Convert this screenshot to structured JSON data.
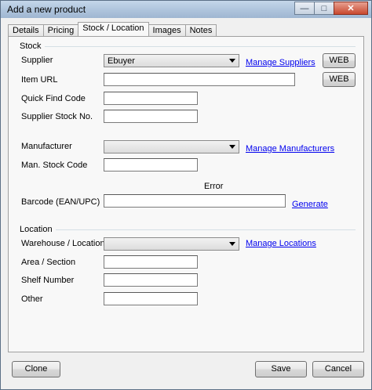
{
  "window": {
    "title": "Add a new product",
    "minimize_glyph": "—",
    "maximize_glyph": "□",
    "close_glyph": "✕"
  },
  "tabs": [
    {
      "label": "Details"
    },
    {
      "label": "Pricing"
    },
    {
      "label": "Stock / Location"
    },
    {
      "label": "Images"
    },
    {
      "label": "Notes"
    }
  ],
  "stock": {
    "group_label": "Stock",
    "supplier_label": "Supplier",
    "supplier_value": "Ebuyer",
    "manage_suppliers": "Manage Suppliers",
    "web_label": "WEB",
    "item_url_label": "Item URL",
    "item_url_value": "",
    "quick_find_label": "Quick Find Code",
    "quick_find_value": "",
    "supplier_stock_label": "Supplier Stock No.",
    "supplier_stock_value": "",
    "manufacturer_label": "Manufacturer",
    "manufacturer_value": "",
    "manage_manufacturers": "Manage Manufacturers",
    "man_stock_label": "Man. Stock Code",
    "man_stock_value": "",
    "error_text": "Error",
    "barcode_label": "Barcode (EAN/UPC)",
    "barcode_value": "",
    "generate_label": "Generate"
  },
  "location": {
    "group_label": "Location",
    "warehouse_label": "Warehouse / Location",
    "warehouse_value": "",
    "manage_locations": "Manage Locations",
    "area_label": "Area / Section",
    "area_value": "",
    "shelf_label": "Shelf Number",
    "shelf_value": "",
    "other_label": "Other",
    "other_value": ""
  },
  "footer": {
    "clone_label": "Clone",
    "save_label": "Save",
    "cancel_label": "Cancel"
  }
}
